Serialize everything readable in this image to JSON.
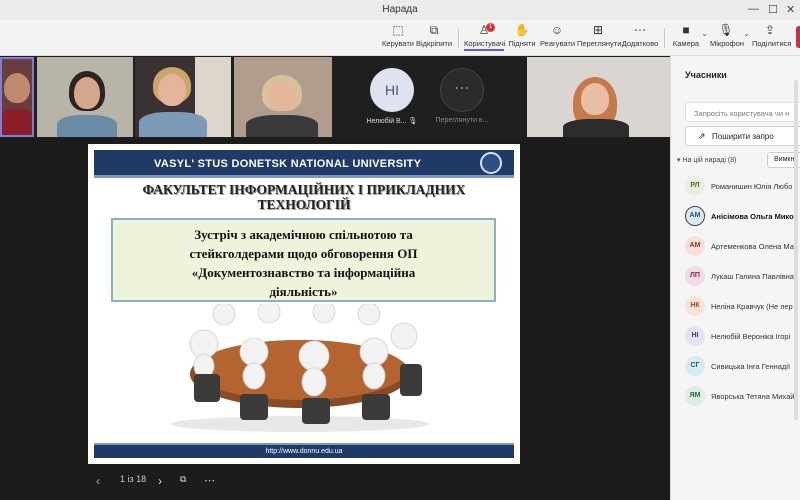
{
  "window": {
    "title": "Нарада"
  },
  "toolbar": {
    "items": [
      {
        "label": "Керувати",
        "icon": "pointer-icon"
      },
      {
        "label": "Відкріпити",
        "icon": "unpin-icon"
      },
      {
        "label": "Користувачі",
        "icon": "people-icon",
        "badge": "1"
      },
      {
        "label": "Підняти",
        "icon": "raise-hand-icon"
      },
      {
        "label": "Реагувати",
        "icon": "smile-icon"
      },
      {
        "label": "Переглянути",
        "icon": "grid-icon"
      },
      {
        "label": "Додатково",
        "icon": "more-icon"
      },
      {
        "label": "Камера",
        "icon": "camera-icon"
      },
      {
        "label": "Мікрофон",
        "icon": "microphone-icon"
      },
      {
        "label": "Поділитися",
        "icon": "share-icon"
      }
    ],
    "leave_color": "#c4314b"
  },
  "video_strip": {
    "avatar_tiles": [
      {
        "initials": "НІ",
        "name": "Нелюбій В..."
      },
      {
        "initials": "⋯",
        "name": "Перегляну­ти в..."
      }
    ]
  },
  "slide": {
    "university": "VASYL' STUS DONETSK NATIONAL UNIVERSITY",
    "faculty": "ФАКУЛЬТЕТ ІНФОРМАЦІЙНИХ І ПРИКЛАДНИХ ТЕХНОЛОГІЙ",
    "meeting_lines": [
      "Зустріч з академічною спільнотою та",
      "стейкголдерами щодо обговорення ОП",
      "«Документознавство та інформаційна",
      "діяльність»"
    ],
    "url": "http://www.donnu.edu.ua"
  },
  "pager": {
    "page": "1 із 18"
  },
  "participants": {
    "title": "Учасники",
    "search_placeholder": "Запросіть користувача чи н",
    "share_label": "Поширити запро",
    "section_label": "На цій нараді (8)",
    "mute_label": "Вимкну",
    "list": [
      {
        "initials": "РЛ",
        "name": "Романишин Юлія Любо",
        "bg": "#e6f0dc",
        "fg": "#4a6b2d",
        "bold": false,
        "ring": false
      },
      {
        "initials": "АМ",
        "name": "Анісімова Ольга Мико",
        "bg": "#dce8f0",
        "fg": "#2d4f6b",
        "bold": true,
        "ring": true
      },
      {
        "initials": "АМ",
        "name": "Артеменкова Олена Ма",
        "bg": "#f7e0d8",
        "fg": "#8a3b22",
        "bold": false,
        "ring": false
      },
      {
        "initials": "ЛП",
        "name": "Лукаш Галина Павлівна",
        "bg": "#f3dbe6",
        "fg": "#7a2d52",
        "bold": false,
        "ring": false
      },
      {
        "initials": "НК",
        "name": "Неліна Кравчук (Не пер",
        "bg": "#f8e3d6",
        "fg": "#9a4a1f",
        "bold": false,
        "ring": false
      },
      {
        "initials": "НІ",
        "name": "Нелюбій Вероніка Ігорі",
        "bg": "#e3e4f3",
        "fg": "#3d3f7a",
        "bold": false,
        "ring": false
      },
      {
        "initials": "СГ",
        "name": "Сивицька Інга Геннадії",
        "bg": "#d9ecf3",
        "fg": "#1f5a73",
        "bold": false,
        "ring": false
      },
      {
        "initials": "ЯМ",
        "name": "Яворська Тетяна Михай",
        "bg": "#dcefe3",
        "fg": "#2a6a45",
        "bold": false,
        "ring": false
      }
    ]
  }
}
